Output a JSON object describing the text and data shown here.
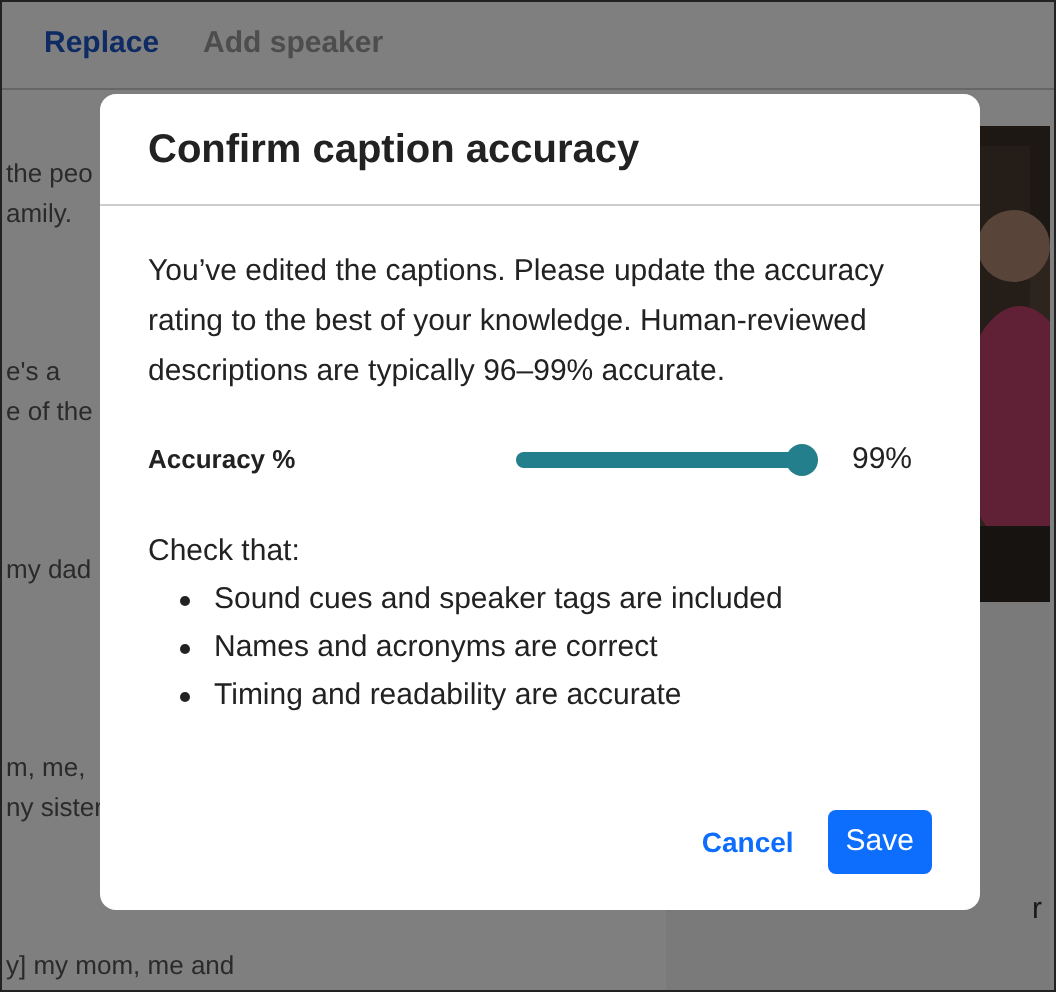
{
  "toolbar": {
    "buttons": [
      {
        "label": "Replace",
        "disabled": false
      },
      {
        "label": "Add speaker",
        "disabled": true
      }
    ]
  },
  "transcript": {
    "paragraphs": [
      {
        "lines": [
          "the peo",
          "amily."
        ]
      },
      {
        "lines": [
          "e's a",
          "e of the"
        ]
      },
      {
        "lines": [
          "my dad"
        ]
      },
      {
        "lines": [
          "m, me,",
          "ny sister"
        ]
      },
      {
        "lines": [
          "y] my mom, me and"
        ]
      }
    ]
  },
  "side_panel": {
    "fragment": "r"
  },
  "dialog": {
    "title": "Confirm caption accuracy",
    "message": "You’ve edited the captions. Please update the accuracy rating to the best of your knowledge. Human-reviewed descriptions are typically 96–99% accurate.",
    "slider": {
      "label": "Accuracy %",
      "level": 0.99,
      "reading": "99%"
    },
    "checklist": {
      "heading": "Check that:",
      "items": [
        "Sound cues and speaker tags are included",
        "Names and acronyms are correct",
        "Timing and readability are accurate"
      ]
    },
    "buttons": [
      {
        "label": "Cancel",
        "kind": "link"
      },
      {
        "label": "Save",
        "kind": "primary"
      }
    ]
  }
}
